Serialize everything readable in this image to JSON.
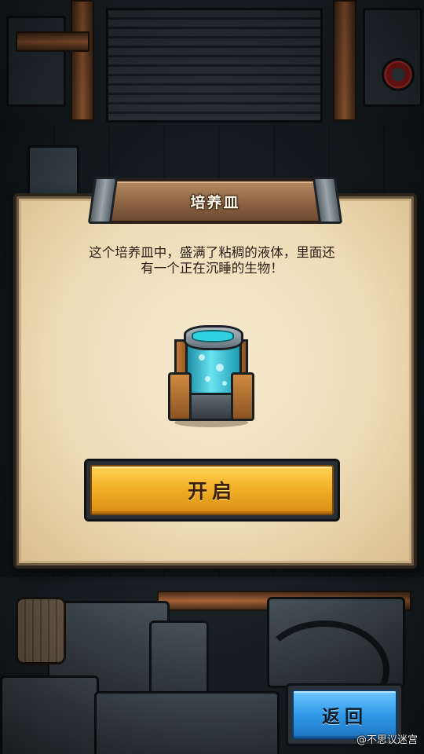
{
  "dialog": {
    "title": "培养皿",
    "description_line1": "这个培养皿中，盛满了粘稠的液体，里面还",
    "description_line2": "有一个正在沉睡的生物！",
    "item_icon": "culture-tank-icon",
    "open_button_label": "开启"
  },
  "footer": {
    "back_button_label": "返回",
    "watermark": "@不思议迷宫"
  },
  "colors": {
    "parchment": "#efdcb7",
    "open_button": "#f3b128",
    "back_button": "#2f9ae8",
    "title_plank": "#8a6040"
  }
}
